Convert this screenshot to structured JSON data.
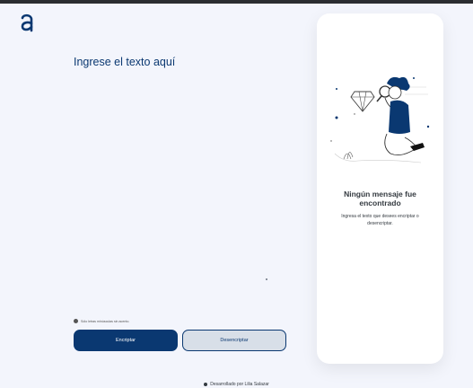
{
  "header": {
    "logo_icon": "alura-a-logo-icon"
  },
  "editor": {
    "placeholder": "Ingrese el texto aquí"
  },
  "hint": {
    "icon": "info-icon",
    "text": "Sólo letras minúsculas sin acento."
  },
  "actions": {
    "encrypt_label": "Encriptar",
    "decrypt_label": "Desencriptar"
  },
  "output_panel": {
    "illustration": "person-with-magnifier-icon",
    "title": "Ningún mensaje fue encontrado",
    "text": "Ingresa el texto que desees encriptar o desencriptar."
  },
  "footer": {
    "text": "Desarrollado por Lilia Salazar"
  },
  "colors": {
    "accent": "#0a3871",
    "background": "#f3f5fc",
    "panel": "#ffffff"
  }
}
